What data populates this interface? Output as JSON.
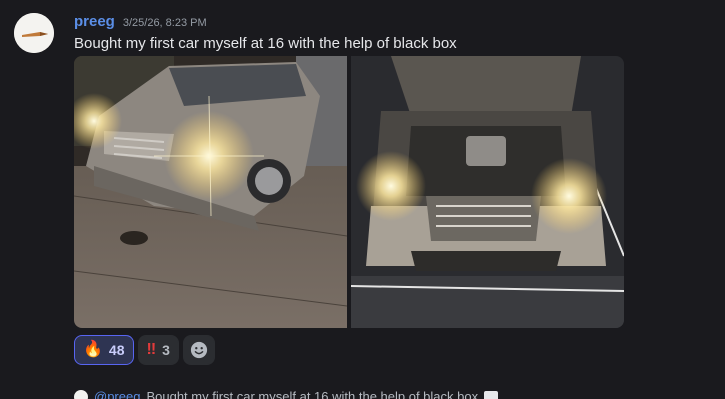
{
  "message": {
    "username": "preeg",
    "timestamp": "3/25/26, 8:23 PM",
    "content": "Bought my first car myself at 16 with the help of black box",
    "attachments": [
      {
        "alt": "Silver sedan parked on driveway with headlights on"
      },
      {
        "alt": "Silver sedan with hood open and headlights on"
      }
    ],
    "reactions": [
      {
        "emoji": "🔥",
        "count": "48",
        "active": true
      },
      {
        "emoji": "‼",
        "count": "3",
        "active": false
      }
    ],
    "add_reaction_icon": "smile-icon"
  },
  "reply_preview": {
    "mention": "@preeg",
    "text": "Bought my first car myself at 16 with the help of black box",
    "icon": "image-icon"
  },
  "colors": {
    "background": "#1a1a1e",
    "username": "#5b8ee6",
    "active_reaction_border": "#5865f2"
  }
}
